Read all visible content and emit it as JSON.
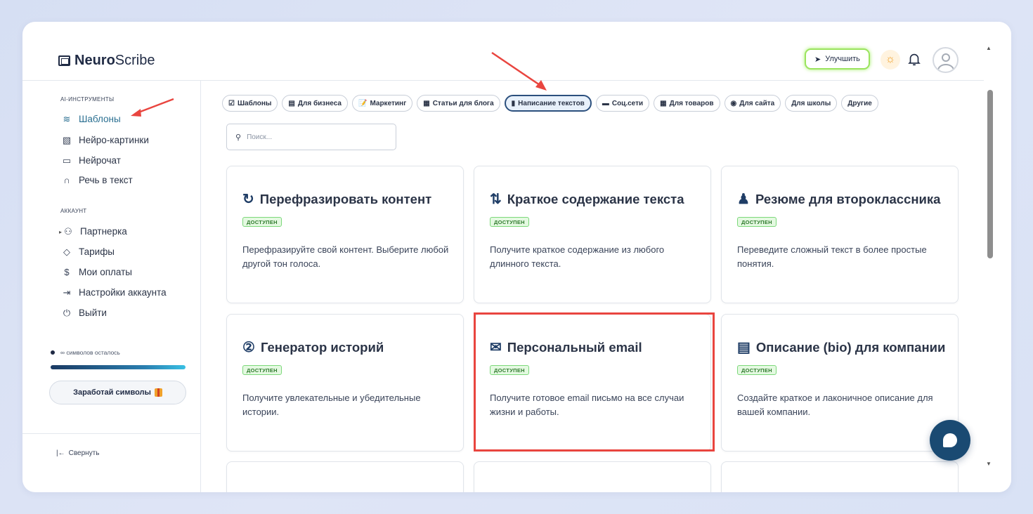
{
  "header": {
    "logo_bold": "Neuro",
    "logo_light": "Scribe",
    "upgrade_label": "Улучшить"
  },
  "sidebar": {
    "ai_section": "AI-ИНСТРУМЕНТЫ",
    "ai_items": [
      {
        "label": "Шаблоны",
        "icon": "layers-icon"
      },
      {
        "label": "Нейро-картинки",
        "icon": "image-icon"
      },
      {
        "label": "Нейрочат",
        "icon": "chat-icon"
      },
      {
        "label": "Речь в текст",
        "icon": "headphones-icon"
      }
    ],
    "account_section": "АККАУНТ",
    "account_items": [
      {
        "label": "Партнерка",
        "icon": "users-icon"
      },
      {
        "label": "Тарифы",
        "icon": "tag-icon"
      },
      {
        "label": "Мои оплаты",
        "icon": "dollar-icon"
      },
      {
        "label": "Настройки аккаунта",
        "icon": "login-icon"
      },
      {
        "label": "Выйти",
        "icon": "power-icon"
      }
    ],
    "symbols_left": "∞ символов осталось",
    "earn_label": "Заработай символы",
    "collapse_label": "Свернуть"
  },
  "chips": [
    {
      "label": "Шаблоны",
      "icon": "☑"
    },
    {
      "label": "Для бизнеса",
      "icon": "▤"
    },
    {
      "label": "Маркетинг",
      "icon": "📝"
    },
    {
      "label": "Статьи для блога",
      "icon": "▦"
    },
    {
      "label": "Написание текстов",
      "icon": "▮",
      "active": true
    },
    {
      "label": "Соц.сети",
      "icon": "▬"
    },
    {
      "label": "Для товаров",
      "icon": "▦"
    },
    {
      "label": "Для сайта",
      "icon": "◉"
    },
    {
      "label": "Для школы",
      "icon": ""
    },
    {
      "label": "Другие",
      "icon": ""
    }
  ],
  "search": {
    "placeholder": "Поиск..."
  },
  "cards": [
    {
      "title": "Перефразировать контент",
      "icon": "↻",
      "badge": "ДОСТУПЕН",
      "desc": "Перефразируйте свой контент. Выберите любой другой тон голоса."
    },
    {
      "title": "Краткое содержание текста",
      "icon": "⇅",
      "badge": "ДОСТУПЕН",
      "desc": "Получите краткое содержание из любого длинного текста."
    },
    {
      "title": "Резюме для второклассника",
      "icon": "♟",
      "badge": "ДОСТУПЕН",
      "desc": "Переведите сложный текст в более простые понятия."
    },
    {
      "title": "Генератор историй",
      "icon": "②",
      "badge": "ДОСТУПЕН",
      "desc": "Получите увлекательные и убедительные истории."
    },
    {
      "title": "Персональный email",
      "icon": "✉",
      "badge": "ДОСТУПЕН",
      "desc": "Получите готовое email письмо на все случаи жизни и работы."
    },
    {
      "title": "Описание (bio) для компании",
      "icon": "▤",
      "badge": "ДОСТУПЕН",
      "desc": "Создайте краткое и лаконичное описание для вашей компании."
    }
  ]
}
